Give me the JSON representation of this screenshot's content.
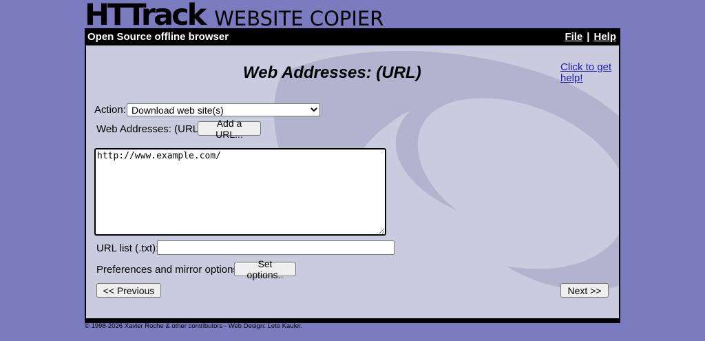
{
  "logo": {
    "main": "HTTrack",
    "sub": "WEBSITE COPIER"
  },
  "topbar": {
    "tagline": "Open Source offline browser",
    "menu": {
      "file": "File",
      "separator": "|",
      "help": "Help"
    }
  },
  "page": {
    "title": "Web Addresses: (URL)",
    "help_link": "Click to get help!"
  },
  "form": {
    "action_label": "Action:",
    "action_selected": "Download web site(s)",
    "web_addresses_label": "Web Addresses: (URL)",
    "add_url_button": "Add a URL...",
    "urls_value": "http://www.example.com/",
    "url_list_label": "URL list (.txt):",
    "url_list_value": "",
    "prefs_label": "Preferences and mirror options:",
    "set_options_button": "Set options.."
  },
  "nav": {
    "previous": "<< Previous",
    "next": "Next >>"
  },
  "footer": {
    "text": "© 1998-2026 Xavier Roche & other contributors - Web Design: Leto Kauler."
  },
  "colors": {
    "background": "#7b7bbf",
    "panel": "#cbcbdf",
    "swirl": "#b3b3cf",
    "link": "#1a1aa8"
  }
}
